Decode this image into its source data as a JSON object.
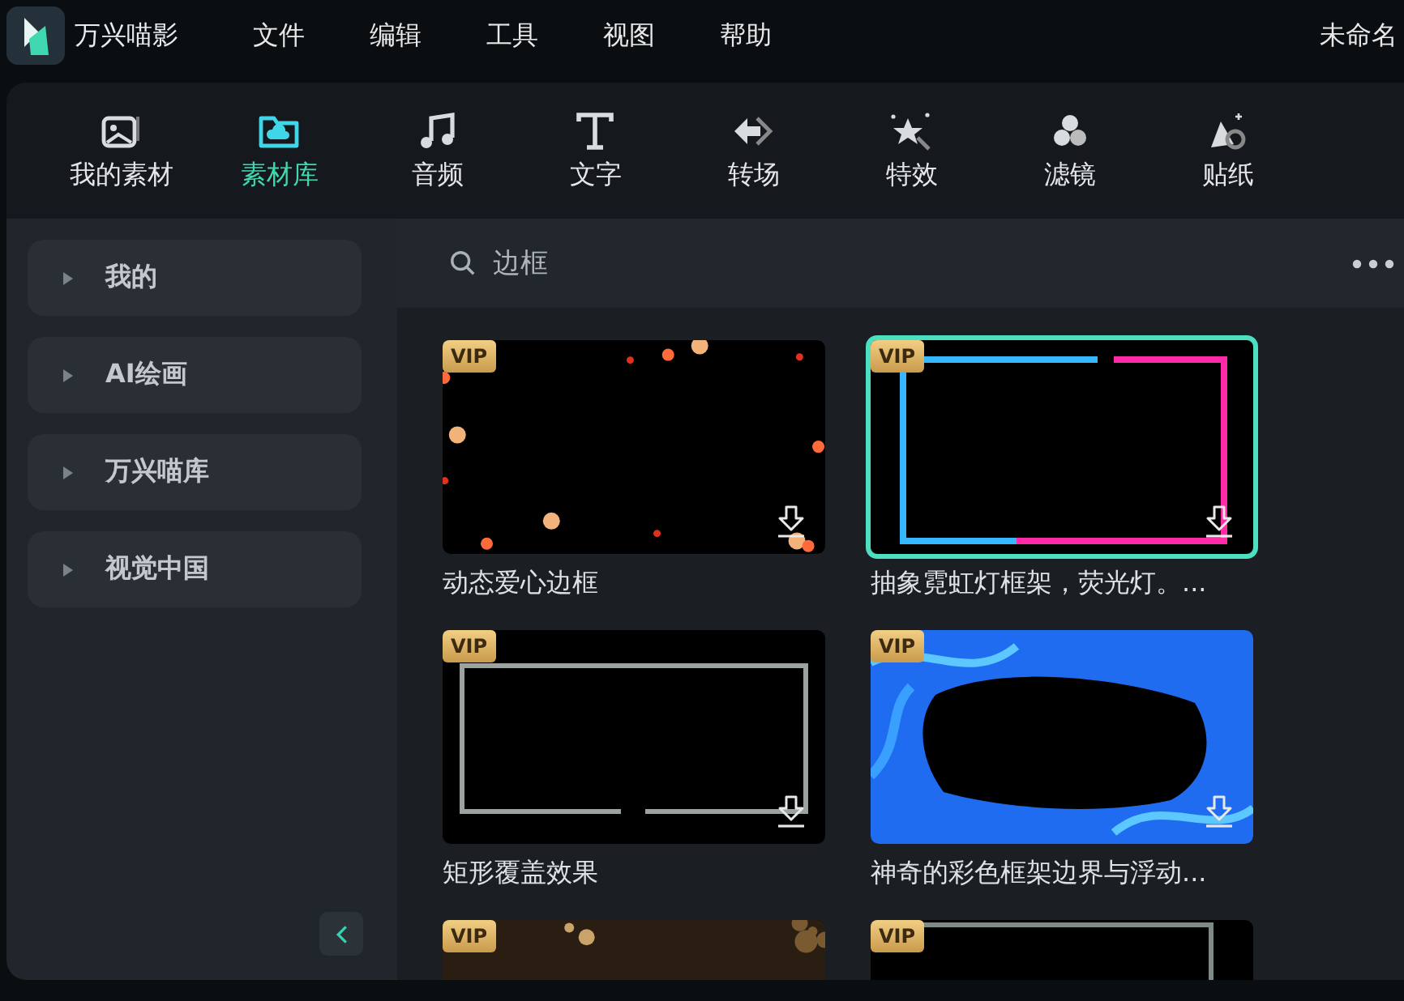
{
  "app": {
    "name": "万兴喵影"
  },
  "menu": [
    "文件",
    "编辑",
    "工具",
    "视图",
    "帮助"
  ],
  "project_title": "未命名",
  "tabs": [
    {
      "label": "我的素材",
      "selected": false
    },
    {
      "label": "素材库",
      "selected": true
    },
    {
      "label": "音频",
      "selected": false
    },
    {
      "label": "文字",
      "selected": false
    },
    {
      "label": "转场",
      "selected": false
    },
    {
      "label": "特效",
      "selected": false
    },
    {
      "label": "滤镜",
      "selected": false
    },
    {
      "label": "贴纸",
      "selected": false
    }
  ],
  "sidebar": {
    "items": [
      {
        "label": "我的"
      },
      {
        "label": "AI绘画"
      },
      {
        "label": "万兴喵库"
      },
      {
        "label": "视觉中国"
      }
    ]
  },
  "search": {
    "value": "边框"
  },
  "items": [
    {
      "title": "动态爱心边框",
      "badge": "VIP",
      "selected": false
    },
    {
      "title": "抽象霓虹灯框架，荧光灯。...",
      "badge": "VIP",
      "selected": true
    },
    {
      "title": "矩形覆盖效果",
      "badge": "VIP",
      "selected": false
    },
    {
      "title": "神奇的彩色框架边界与浮动...",
      "badge": "VIP",
      "selected": false
    },
    {
      "badge": "VIP",
      "selected": false
    },
    {
      "badge": "VIP",
      "selected": false
    }
  ]
}
